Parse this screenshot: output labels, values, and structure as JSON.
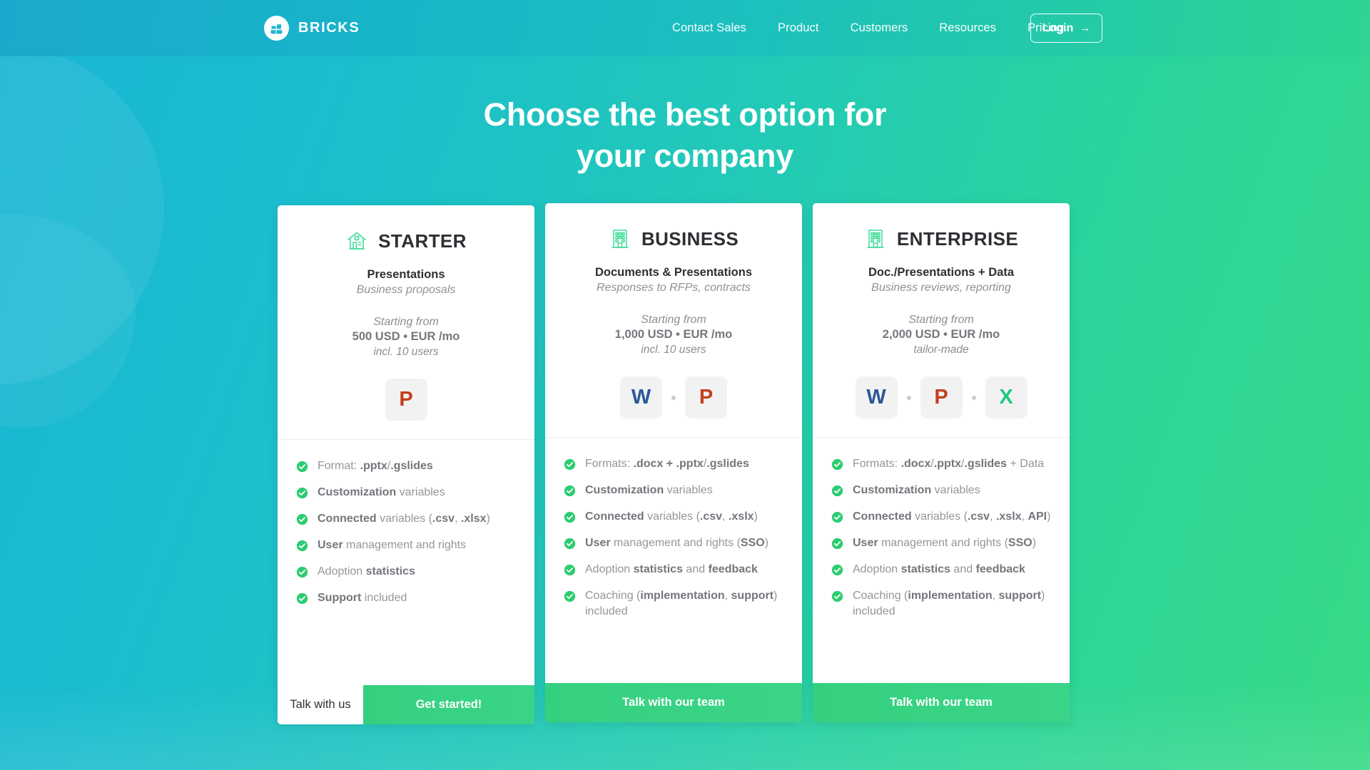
{
  "header": {
    "brand": {
      "name": "BRICKS",
      "logo_icon": "bricks-logo-icon"
    },
    "nav": [
      {
        "label": "Contact Sales"
      },
      {
        "label": "Product"
      },
      {
        "label": "Customers"
      },
      {
        "label": "Resources"
      },
      {
        "label": "Pricing"
      }
    ],
    "login": {
      "label": "Login",
      "arrow": "→"
    }
  },
  "hero": {
    "headline_line1": "Choose the best option for",
    "headline_line2": "your company"
  },
  "colors": {
    "header_start": "#1aa9cc",
    "header_end": "#2ed491",
    "page_start": "#19b5d6",
    "page_end": "#38da86",
    "accent_green": "#35d07f",
    "check_green": "#2ecc71",
    "plan_icon_green": "#3ddc97",
    "word_blue": "#2b579a",
    "powerpoint_red": "#c43e1c",
    "excel_green": "#21c97a",
    "title_dark": "#2d2f33",
    "muted_text": "#93969b"
  },
  "plans": [
    {
      "id": "starter",
      "name": "STARTER",
      "icon": "house-icon",
      "subtitle": "Presentations",
      "usecase": "Business proposals",
      "price_from": "Starting from",
      "price_main": "500 USD • EUR /mo",
      "price_note": "incl. 10 users",
      "apps": [
        {
          "letter": "P",
          "name": "powerpoint-icon",
          "color": "#c43e1c"
        }
      ],
      "features": [
        "Format: <b>.pptx</b>/<b>.gslides</b>",
        "<b>Customization</b> variables",
        "<b>Connected</b> variables (<b>.csv</b>, <b>.xlsx</b>)",
        "<b>User</b> management and rights",
        "Adoption <b>statistics</b>",
        "<b>Support</b> included"
      ],
      "footer": {
        "secondary_label": "Talk with us",
        "primary_label": "Get started!"
      }
    },
    {
      "id": "business",
      "name": "BUSINESS",
      "icon": "office-building-icon",
      "subtitle": "Documents & Presentations",
      "usecase": "Responses to RFPs, contracts",
      "price_from": "Starting from",
      "price_main": "1,000 USD • EUR /mo",
      "price_note": "incl. 10 users",
      "apps": [
        {
          "letter": "W",
          "name": "word-icon",
          "color": "#2b579a"
        },
        {
          "letter": "P",
          "name": "powerpoint-icon",
          "color": "#c43e1c"
        }
      ],
      "features": [
        "Formats: <b>.docx + .pptx</b>/<b>.gslides</b>",
        "<b>Customization</b> variables",
        "<b>Connected</b> variables (<b>.csv</b>, <b>.xslx</b>)",
        "<b>User</b> management and rights (<b>SSO</b>)",
        "Adoption <b>statistics</b> and <b>feedback</b>",
        "Coaching (<b>implementation</b>, <b>support</b>) included"
      ],
      "footer": {
        "secondary_label": "",
        "primary_label": "Talk with our team"
      }
    },
    {
      "id": "enterprise",
      "name": "ENTERPRISE",
      "icon": "office-building-icon",
      "subtitle": "Doc./Presentations + Data",
      "usecase": "Business reviews, reporting",
      "price_from": "Starting from",
      "price_main": "2,000 USD • EUR /mo",
      "price_note": "tailor-made",
      "apps": [
        {
          "letter": "W",
          "name": "word-icon",
          "color": "#2b579a"
        },
        {
          "letter": "P",
          "name": "powerpoint-icon",
          "color": "#c43e1c"
        },
        {
          "letter": "X",
          "name": "excel-icon",
          "color": "#21c97a"
        }
      ],
      "features": [
        "Formats: <b>.docx</b>/<b>.pptx</b>/<b>.gslides</b> + Data",
        "<b>Customization</b> variables",
        "<b>Connected</b> variables (<b>.csv</b>, <b>.xslx</b>, <b>API</b>)",
        "<b>User</b> management and rights (<b>SSO</b>)",
        "Adoption <b>statistics</b> and <b>feedback</b>",
        "Coaching (<b>implementation</b>, <b>support</b>) included"
      ],
      "footer": {
        "secondary_label": "",
        "primary_label": "Talk with our team"
      }
    }
  ]
}
